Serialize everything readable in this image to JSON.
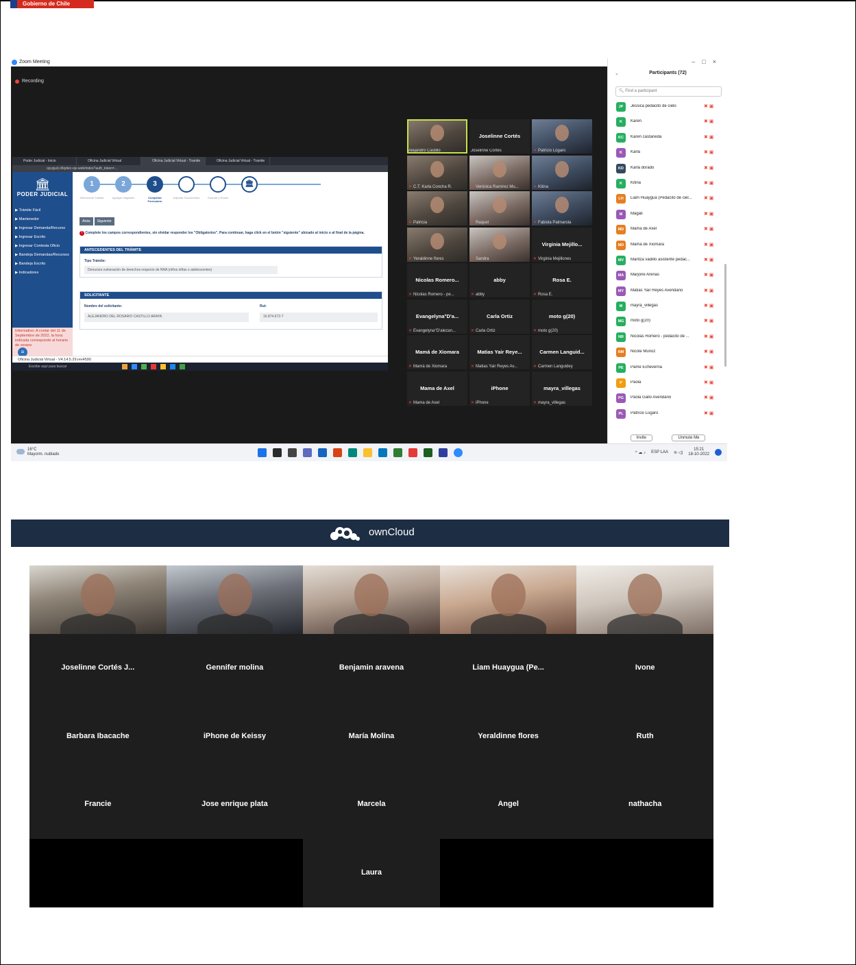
{
  "gov_tag": "Gobierno de Chile",
  "zoom": {
    "window_title": "Zoom Meeting",
    "recording_label": "Recording",
    "browser": {
      "tabs": [
        "Poder Judicial - Inicio",
        "Oficina Judicial Virtual",
        "Oficina Judicial Virtual - Tramite",
        "Oficina Judicial Virtual - Tramite"
      ],
      "url": "ojv.pjud.cl/kpitec-ojv-web/index?auth_token=..."
    },
    "pj": {
      "logo_name": "PODER JUDICIAL",
      "menu": [
        "Trámite Fácil",
        "Mantenedor",
        "Ingresar Demanda/Recurso",
        "Ingresar Escrito",
        "Ingresar Contesta Oficio",
        "Bandeja Demandas/Recursos",
        "Bandeja Escrito",
        "Indicadores"
      ],
      "info_text": "Informativo: A contar del 11 de Septiembre de 2022, la hora indicada corresponde al horario de verano",
      "steps": [
        {
          "num": "1",
          "label": "Seleccionar Trámite"
        },
        {
          "num": "2",
          "label": "Agregar Litigantes"
        },
        {
          "num": "3",
          "label": "Completar Formulario"
        },
        {
          "num": "",
          "label": "Adjuntar Documentos"
        },
        {
          "num": "",
          "label": "Guardar y Enviar"
        }
      ],
      "btn_back": "Atrás",
      "btn_next": "Siguiente",
      "warning": "Complete los campos correspondientes, sin olvidar responder los \"Obligatorios\". Para continuar, haga click en el botón \"siguiente\" ubicado al inicio o al final de la página.",
      "section1_title": "ANTECEDENTES DEL TRÁMITE",
      "tipo_label": "Tipo Trámite:",
      "tipo_value": "Denuncia vulneración de derechos respecto de NNA (niños niñas o adolescentes)",
      "section2_title": "SOLICITANTE",
      "nombre_label": "Nombre del solicitante:",
      "nombre_value": "ALEJANDRO DEL ROSARIO CASTILLO ARAYA",
      "rut_label": "Rut:",
      "rut_value": "16.874.672-7",
      "footer": "Oficina Judicial Virtual  -  V4.14.5.29.rev4590",
      "taskbar_search": "Escribe aquí para buscar"
    },
    "video_tiles": [
      {
        "name": "",
        "sub": "Alejandro Castillo",
        "cam": true
      },
      {
        "name": "Joselinne Cortés",
        "sub": "Joselinne Cortés",
        "cam": false
      },
      {
        "name": "",
        "sub": "Patricio Lúgaro",
        "cam": true
      },
      {
        "name": "",
        "sub": "C.T. Karla Concha R.",
        "cam": true
      },
      {
        "name": "",
        "sub": "Verónica Ramírez Mu...",
        "cam": true
      },
      {
        "name": "",
        "sub": "Kitina",
        "cam": true
      },
      {
        "name": "",
        "sub": "Patricia",
        "cam": true
      },
      {
        "name": "",
        "sub": "Raquel",
        "cam": true
      },
      {
        "name": "",
        "sub": "Fabiola Palmarola",
        "cam": true
      },
      {
        "name": "",
        "sub": "Yeraldinne flores",
        "cam": true
      },
      {
        "name": "",
        "sub": "Sandra",
        "cam": true
      },
      {
        "name": "Virginia Mejillo...",
        "sub": "Virginia Mejillones",
        "cam": false
      },
      {
        "name": "Nicolas Romero...",
        "sub": "Nicolas Romero - pe...",
        "cam": false
      },
      {
        "name": "abby",
        "sub": "abby",
        "cam": false
      },
      {
        "name": "Rosa E.",
        "sub": "Rosa E.",
        "cam": false
      },
      {
        "name": "Evangelyna°D'a...",
        "sub": "Evangelyna°D'alezan...",
        "cam": false
      },
      {
        "name": "Carla Ortiz",
        "sub": "Carla Ortiz",
        "cam": false
      },
      {
        "name": "moto g(20)",
        "sub": "moto g(20)",
        "cam": false
      },
      {
        "name": "Mamá de Xiomara",
        "sub": "Mamá de Xiomara",
        "cam": false
      },
      {
        "name": "Matias Yair Reye...",
        "sub": "Matias Yair Reyes Av...",
        "cam": false
      },
      {
        "name": "Carmen Languid...",
        "sub": "Carmen Languidey",
        "cam": false
      },
      {
        "name": "Mama de Axel",
        "sub": "Mama de Axel",
        "cam": false
      },
      {
        "name": "iPhone",
        "sub": "iPhone",
        "cam": false
      },
      {
        "name": "mayra_villegas",
        "sub": "mayra_villegas",
        "cam": false
      }
    ],
    "participants": {
      "title": "Participants (72)",
      "search_placeholder": "Find a participant",
      "list": [
        {
          "initials": "JP",
          "name": "Jessica pedacito de cielo",
          "color": "#27ae60"
        },
        {
          "initials": "K",
          "name": "Karen",
          "color": "#27ae60"
        },
        {
          "initials": "KC",
          "name": "Karen castañeda",
          "color": "#27ae60"
        },
        {
          "initials": "K",
          "name": "Karla",
          "color": "#9b59b6"
        },
        {
          "initials": "KD",
          "name": "Karla dorado",
          "color": "#34495e"
        },
        {
          "initials": "K",
          "name": "Kitina",
          "color": "#27ae60"
        },
        {
          "initials": "LH",
          "name": "Liam Huaygua (Pedacito de ciel...",
          "color": "#e67e22"
        },
        {
          "initials": "M",
          "name": "Magali",
          "color": "#9b59b6"
        },
        {
          "initials": "MD",
          "name": "Mama de Axel",
          "color": "#e67e22"
        },
        {
          "initials": "MD",
          "name": "Mamá de Xiomara",
          "color": "#e67e22"
        },
        {
          "initials": "MV",
          "name": "Maritza vadillo asistente pedac...",
          "color": "#27ae60"
        },
        {
          "initials": "MA",
          "name": "Marjorie Arenas",
          "color": "#9b59b6"
        },
        {
          "initials": "MY",
          "name": "Matias Yair Reyes Avendaño",
          "color": "#9b59b6"
        },
        {
          "initials": "M",
          "name": "mayra_villegas",
          "color": "#27ae60"
        },
        {
          "initials": "MG",
          "name": "moto g(20)",
          "color": "#27ae60"
        },
        {
          "initials": "NR",
          "name": "Nicolas Romero - pedacito de ...",
          "color": "#27ae60"
        },
        {
          "initials": "NM",
          "name": "Nicole Muñoz",
          "color": "#e67e22"
        },
        {
          "initials": "PE",
          "name": "Pame Echeverria",
          "color": "#27ae60"
        },
        {
          "initials": "P",
          "name": "Paola",
          "color": "#f39c12"
        },
        {
          "initials": "PG",
          "name": "Paola Gallo Avendaño",
          "color": "#9b59b6"
        },
        {
          "initials": "PL",
          "name": "Patricio Lúgaro",
          "color": "#9b59b6"
        }
      ],
      "invite_label": "Invite",
      "unmute_label": "Unmute Me"
    },
    "taskbar": {
      "temp": "16°C",
      "weather": "Mayorm. nublado",
      "lang": "ESP LAA",
      "time": "15:21",
      "date": "18-10-2022"
    }
  },
  "owncloud": {
    "brand": "ownCloud"
  },
  "meeting_grid": [
    {
      "name": "",
      "cam": "a"
    },
    {
      "name": "",
      "cam": "b"
    },
    {
      "name": "",
      "cam": "c"
    },
    {
      "name": "",
      "cam": "d"
    },
    {
      "name": "",
      "cam": "e"
    },
    {
      "name": "Joselinne Cortés J...",
      "cam": ""
    },
    {
      "name": "Gennifer molina",
      "cam": ""
    },
    {
      "name": "Benjamin aravena",
      "cam": ""
    },
    {
      "name": "Liam Huaygua (Pe...",
      "cam": ""
    },
    {
      "name": "Ivone",
      "cam": ""
    },
    {
      "name": "Barbara Ibacache",
      "cam": ""
    },
    {
      "name": "iPhone de Keissy",
      "cam": ""
    },
    {
      "name": "María Molina",
      "cam": ""
    },
    {
      "name": "Yeraldinne flores",
      "cam": ""
    },
    {
      "name": "Ruth",
      "cam": ""
    },
    {
      "name": "Francie",
      "cam": ""
    },
    {
      "name": "Jose enrique plata",
      "cam": ""
    },
    {
      "name": "Marcela",
      "cam": ""
    },
    {
      "name": "Angel",
      "cam": ""
    },
    {
      "name": "nathacha",
      "cam": ""
    },
    {
      "name": "",
      "cam": "black"
    },
    {
      "name": "",
      "cam": "black"
    },
    {
      "name": "Laura",
      "cam": ""
    },
    {
      "name": "",
      "cam": "black"
    },
    {
      "name": "",
      "cam": "black"
    }
  ]
}
